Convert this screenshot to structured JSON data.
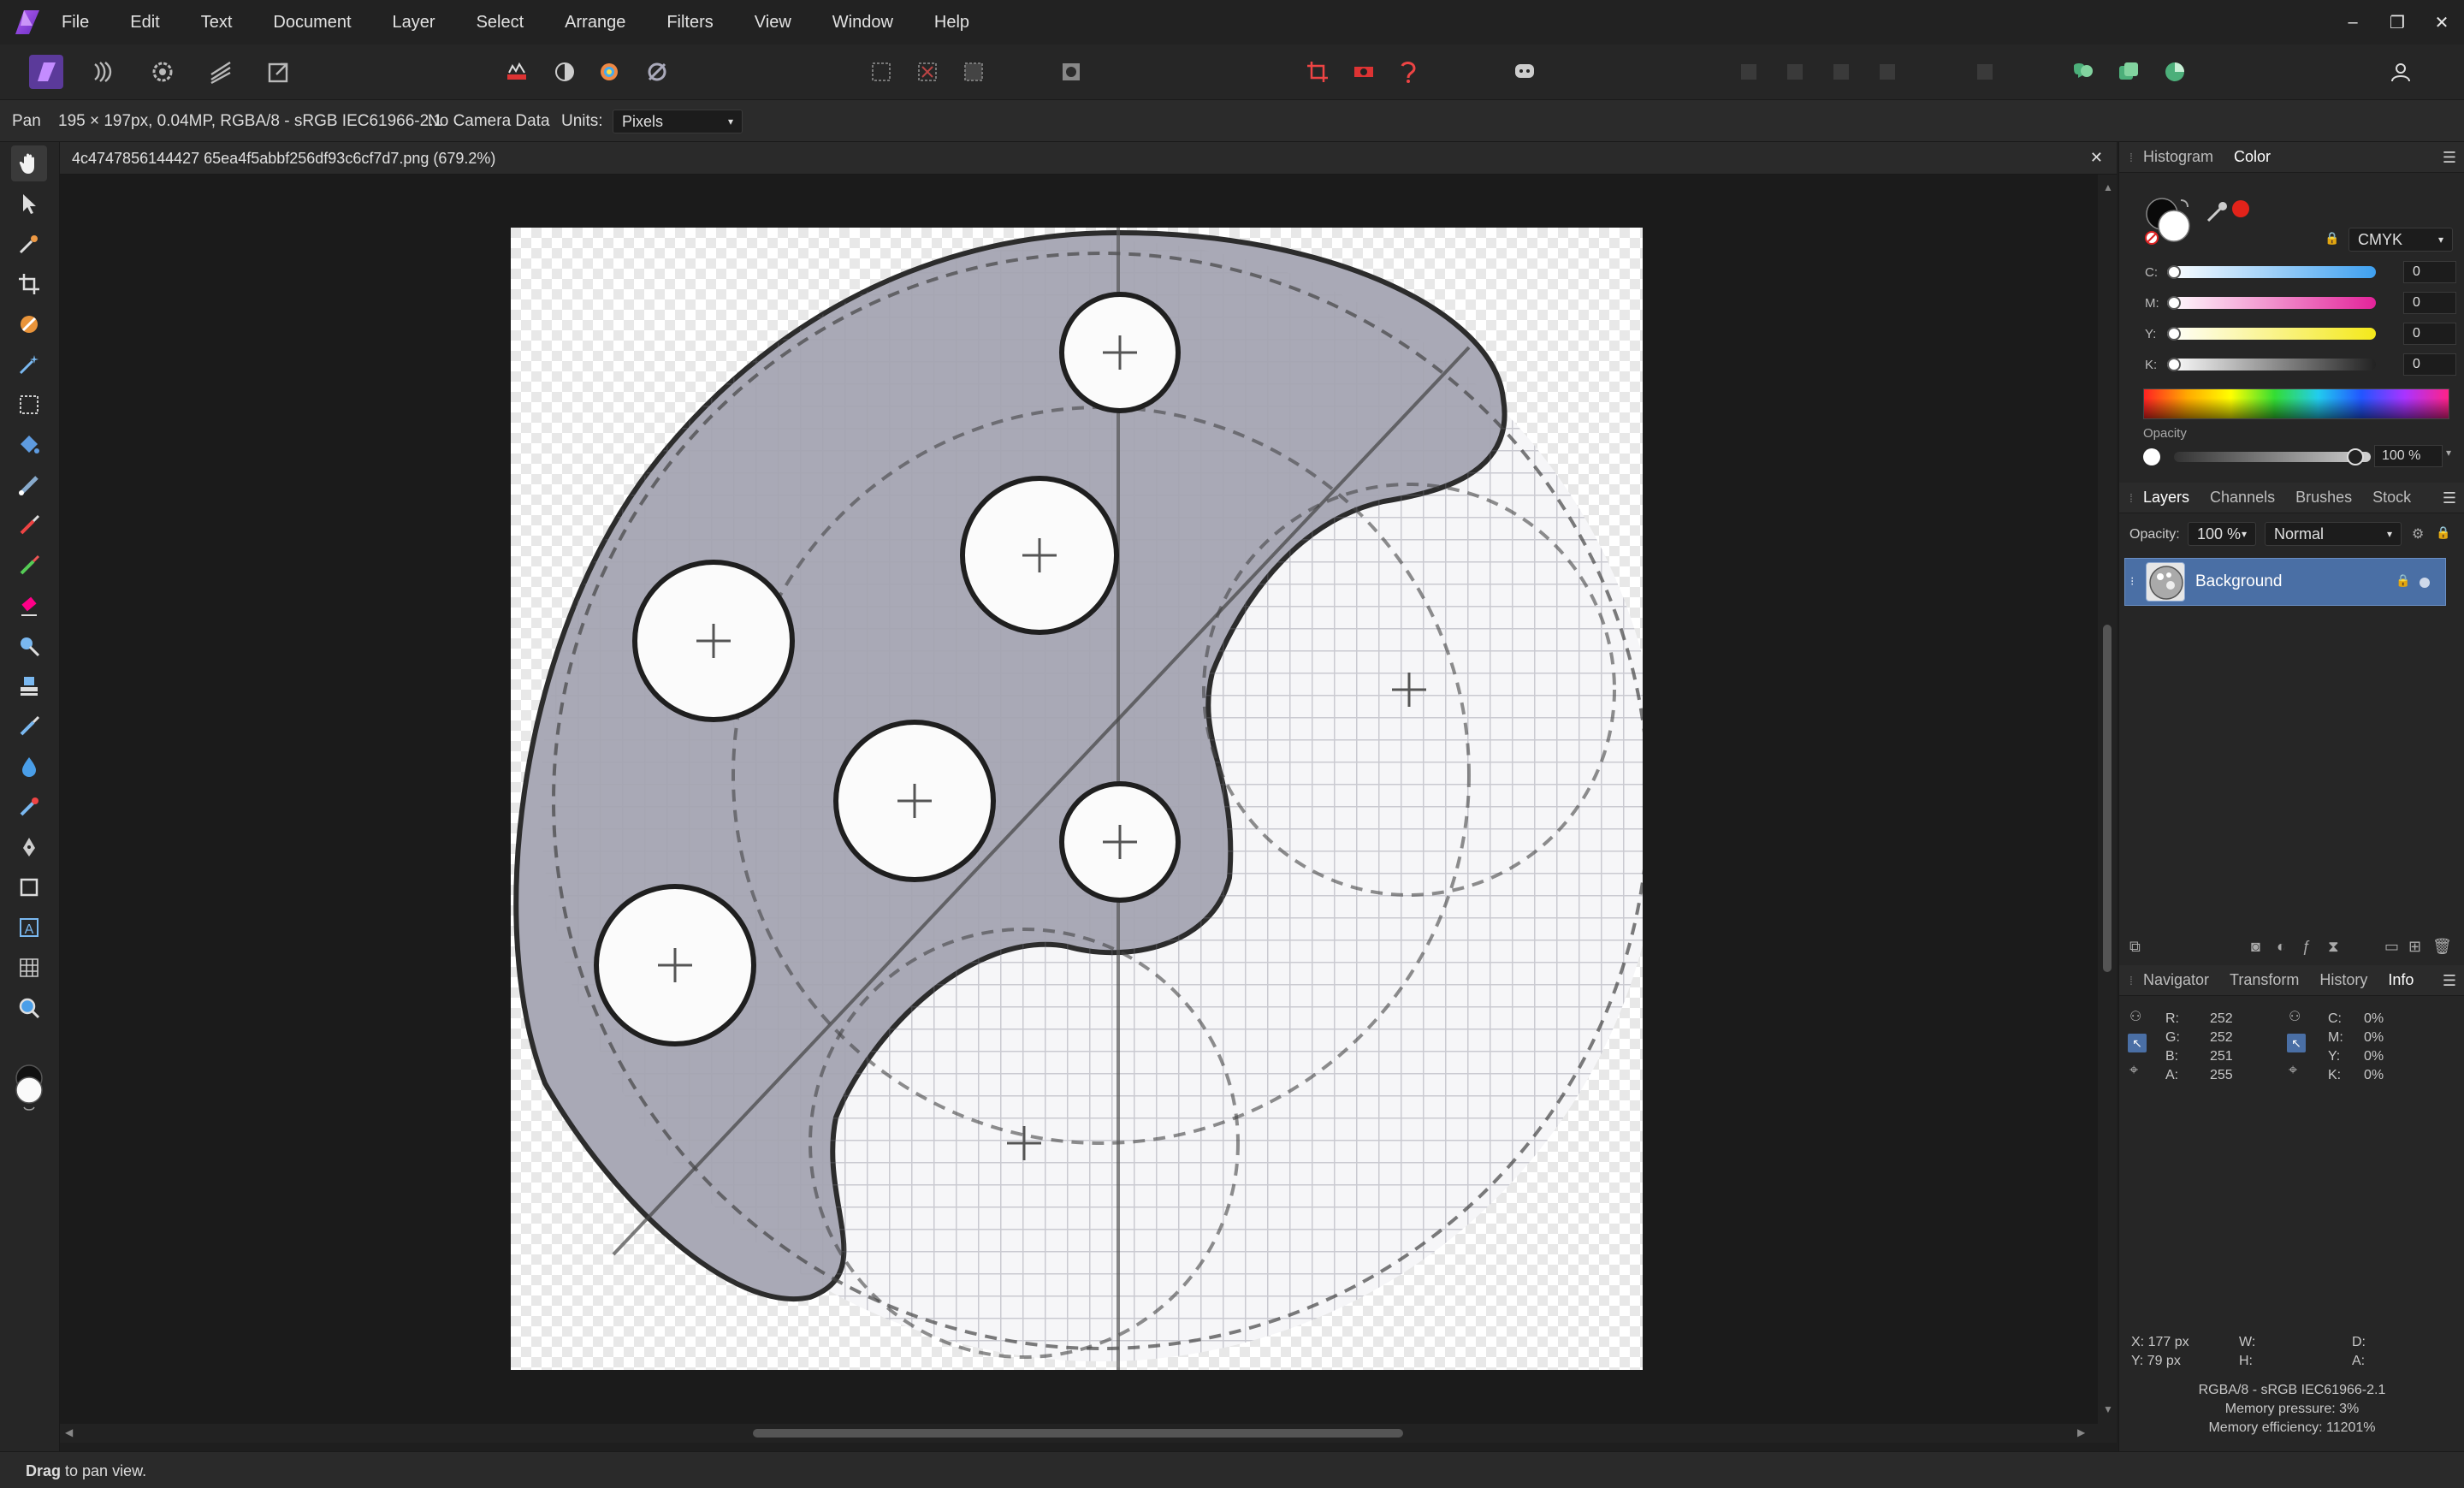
{
  "app": {
    "menu": [
      "File",
      "Edit",
      "Text",
      "Document",
      "Layer",
      "Select",
      "Arrange",
      "Filters",
      "View",
      "Window",
      "Help"
    ],
    "window_controls": {
      "minimize": "–",
      "restore": "❐",
      "close": "✕"
    }
  },
  "context_bar": {
    "tool": "Pan",
    "doc_info": "195 × 197px, 0.04MP, RGBA/8 - sRGB IEC61966-2.1",
    "camera": "No Camera Data",
    "units_label": "Units:",
    "units_value": "Pixels"
  },
  "document": {
    "tab_title": "4c4747856144427 65ea4f5abbf256df93c6cf7d7.png (679.2%)",
    "close": "✕"
  },
  "status": {
    "bold": "Drag",
    "text": " to pan view."
  },
  "color_panel": {
    "tabs": [
      "Histogram",
      "Color"
    ],
    "active_tab": "Color",
    "model": "CMYK",
    "channels": [
      {
        "label": "C:",
        "value": "0",
        "gradient": "#5aa8e8"
      },
      {
        "label": "M:",
        "value": "0",
        "gradient": "#e34aa8"
      },
      {
        "label": "Y:",
        "value": "0",
        "gradient": "#f1e640"
      },
      {
        "label": "K:",
        "value": "0",
        "gradient": "#444444"
      }
    ],
    "opacity_label": "Opacity",
    "opacity_value": "100 %"
  },
  "layers_panel": {
    "tabs": [
      "Layers",
      "Channels",
      "Brushes",
      "Stock"
    ],
    "active_tab": "Layers",
    "opacity_label": "Opacity:",
    "opacity_value": "100 %",
    "blend_mode": "Normal",
    "layers": [
      {
        "name": "Background"
      }
    ]
  },
  "info_panel": {
    "tabs": [
      "Navigator",
      "Transform",
      "History",
      "Info"
    ],
    "active_tab": "Info",
    "rgba": [
      {
        "label": "R:",
        "value": "252"
      },
      {
        "label": "G:",
        "value": "252"
      },
      {
        "label": "B:",
        "value": "251"
      },
      {
        "label": "A:",
        "value": "255"
      }
    ],
    "cmyk": [
      {
        "label": "C:",
        "value": "0%"
      },
      {
        "label": "M:",
        "value": "0%"
      },
      {
        "label": "Y:",
        "value": "0%"
      },
      {
        "label": "K:",
        "value": "0%"
      }
    ],
    "pos": {
      "x": "X: 177 px",
      "y": "Y: 79 px",
      "w": "W:",
      "h": "H:",
      "d": "D:",
      "a": "A:"
    },
    "footer": [
      "RGBA/8 - sRGB IEC61966-2.1",
      "Memory pressure: 3%",
      "Memory efficiency: 11201%"
    ]
  },
  "colors": {
    "accent": "#4a6fa5",
    "layer_selected": "#4a6fa5",
    "brand": "#8e4dd8"
  }
}
